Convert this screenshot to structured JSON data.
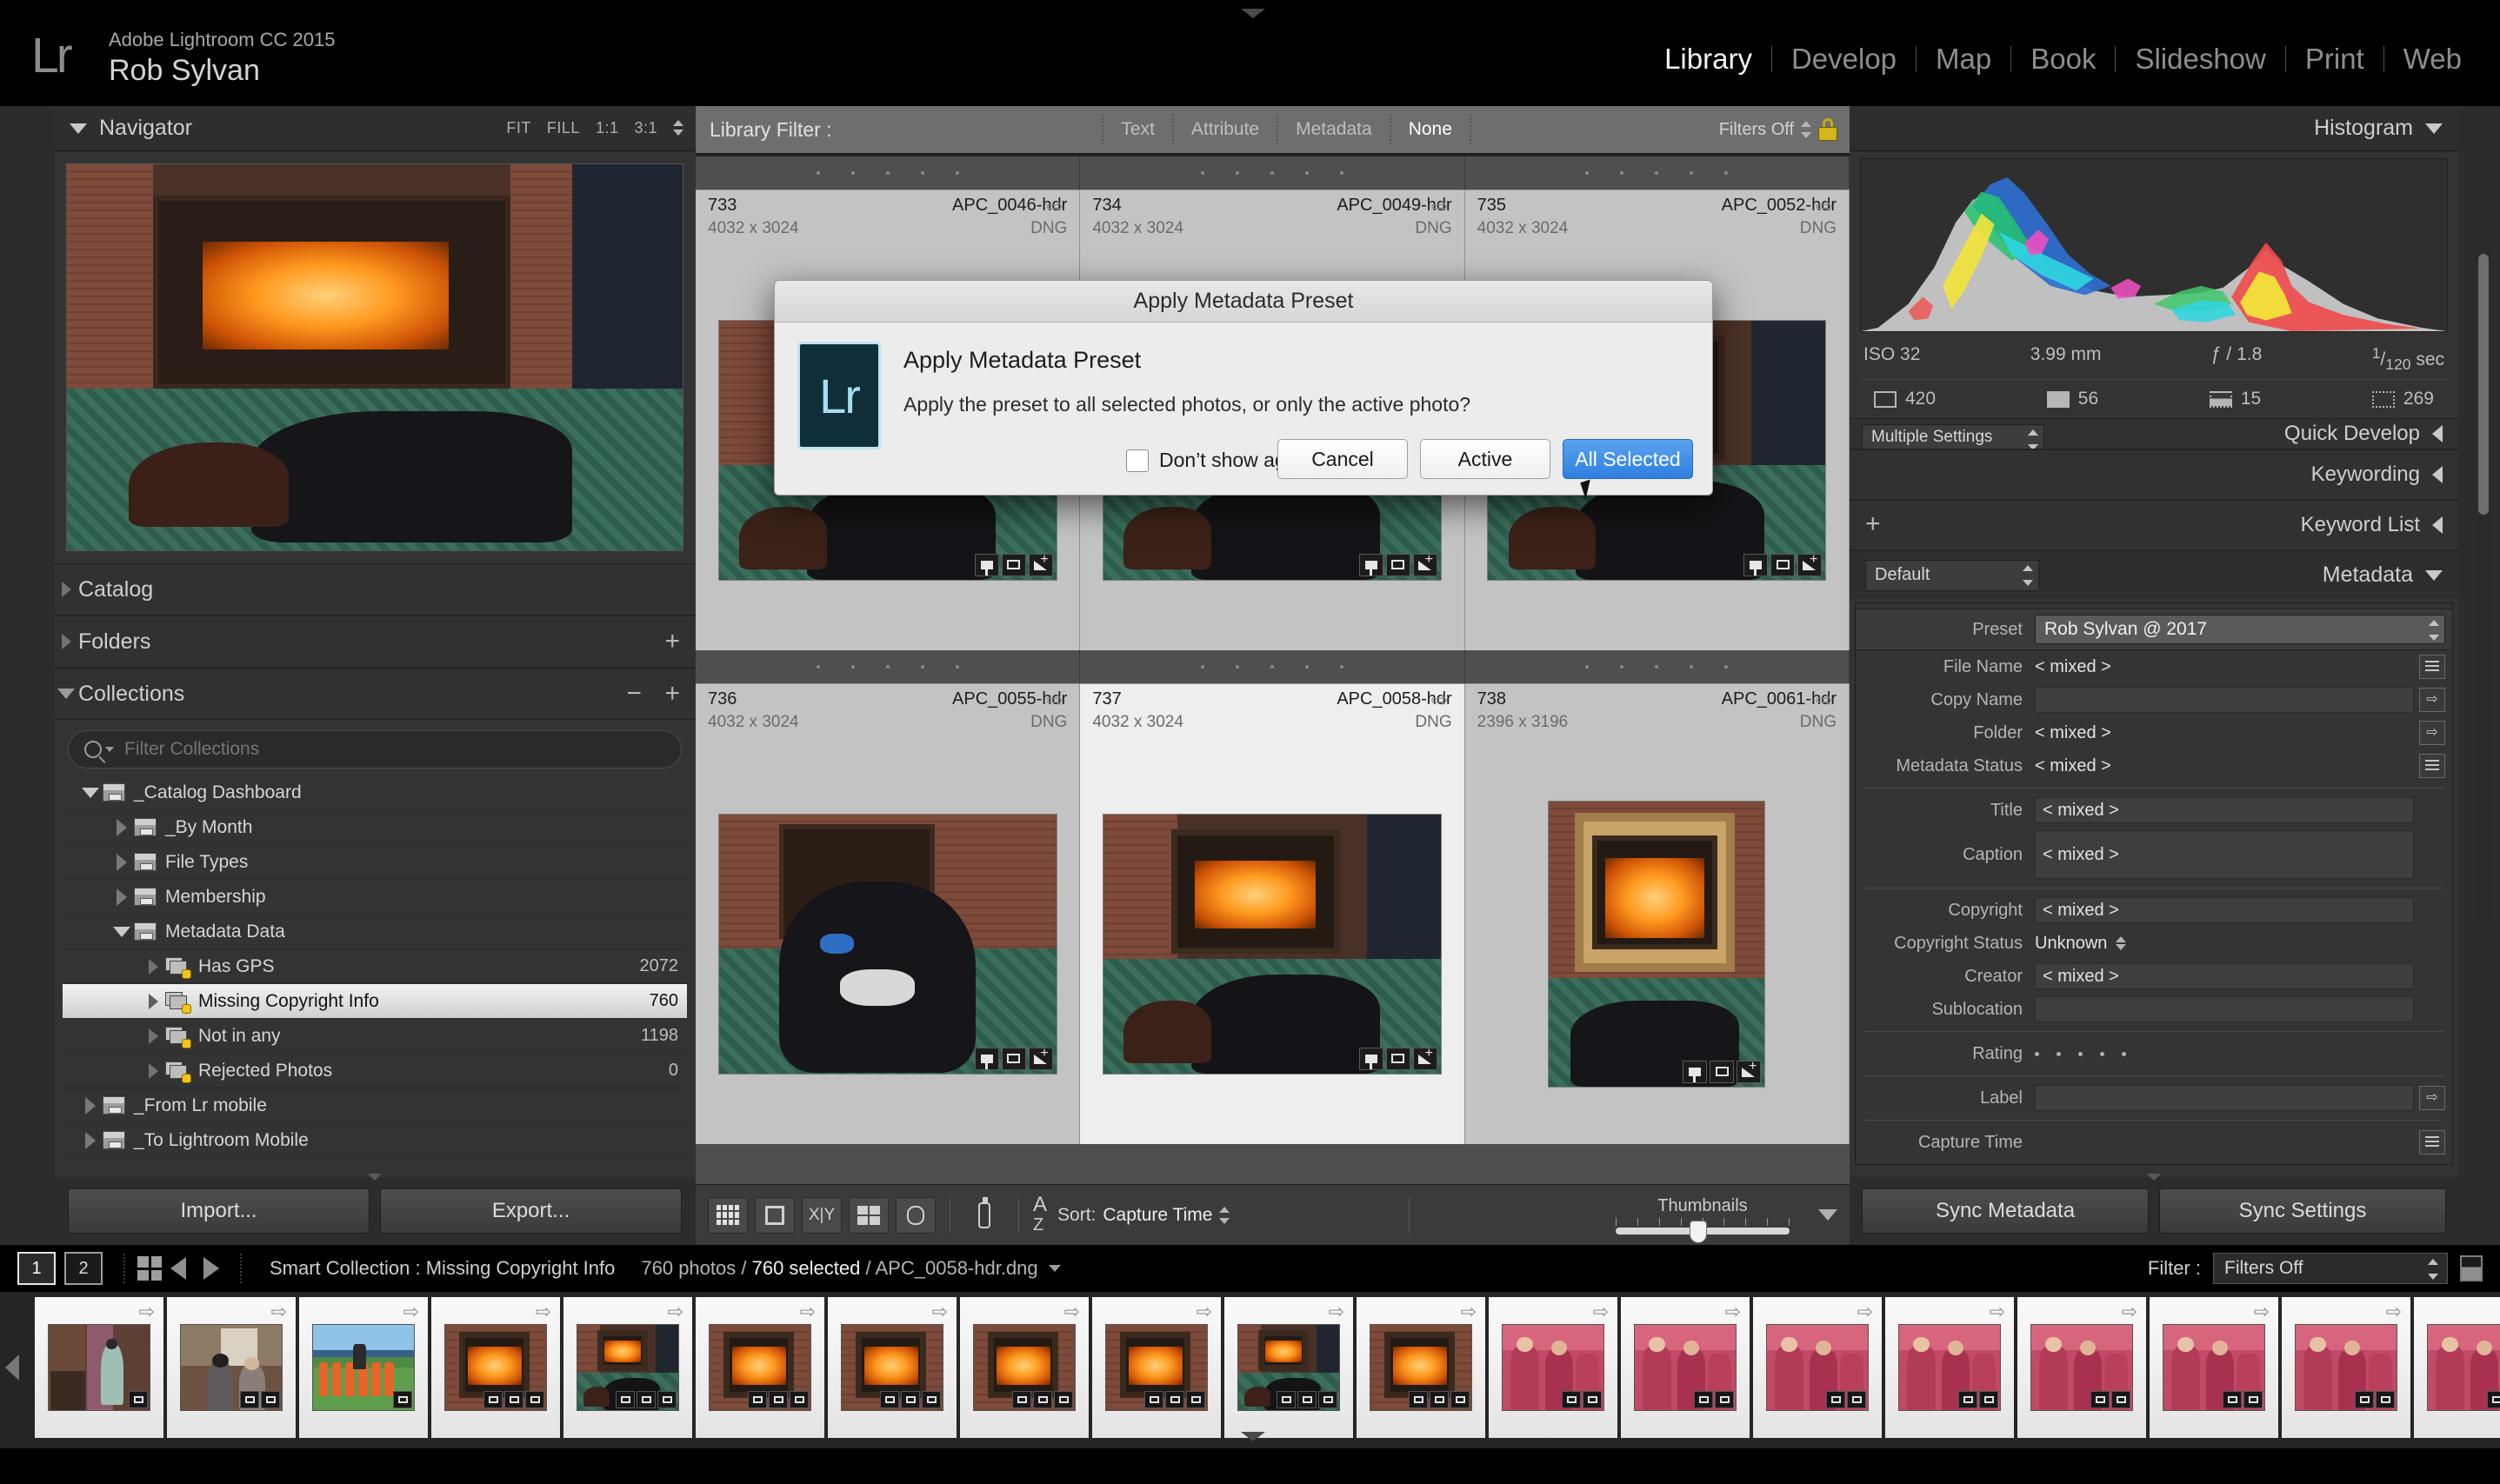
{
  "app": {
    "logo": "Lr",
    "identity_line1": "Adobe Lightroom CC 2015",
    "identity_line2": "Rob Sylvan"
  },
  "modules": [
    {
      "label": "Library",
      "active": true
    },
    {
      "label": "Develop",
      "active": false
    },
    {
      "label": "Map",
      "active": false
    },
    {
      "label": "Book",
      "active": false
    },
    {
      "label": "Slideshow",
      "active": false
    },
    {
      "label": "Print",
      "active": false
    },
    {
      "label": "Web",
      "active": false
    }
  ],
  "left_panel": {
    "navigator": {
      "title": "Navigator",
      "zoom_levels": [
        "FIT",
        "FILL",
        "1:1",
        "3:1"
      ]
    },
    "sections": [
      {
        "label": "Catalog",
        "expanded": false
      },
      {
        "label": "Folders",
        "expanded": false
      },
      {
        "label": "Collections",
        "expanded": true
      }
    ],
    "filter_placeholder": "Filter Collections",
    "collections": [
      {
        "label": "_Catalog Dashboard",
        "count": "",
        "indent": 0,
        "expanded": true,
        "type": "set",
        "selected": false
      },
      {
        "label": "_By Month",
        "count": "",
        "indent": 1,
        "expanded": false,
        "type": "set",
        "selected": false
      },
      {
        "label": "File Types",
        "count": "",
        "indent": 1,
        "expanded": false,
        "type": "set",
        "selected": false
      },
      {
        "label": "Membership",
        "count": "",
        "indent": 1,
        "expanded": false,
        "type": "set",
        "selected": false
      },
      {
        "label": "Metadata Data",
        "count": "",
        "indent": 1,
        "expanded": true,
        "type": "set",
        "selected": false
      },
      {
        "label": "Has GPS",
        "count": "2072",
        "indent": 2,
        "expanded": false,
        "type": "smart",
        "selected": false
      },
      {
        "label": "Missing Copyright Info",
        "count": "760",
        "indent": 2,
        "expanded": false,
        "type": "smart",
        "selected": true
      },
      {
        "label": "Not in any",
        "count": "1198",
        "indent": 2,
        "expanded": false,
        "type": "smart",
        "selected": false
      },
      {
        "label": "Rejected Photos",
        "count": "0",
        "indent": 2,
        "expanded": false,
        "type": "smart",
        "selected": false
      },
      {
        "label": "_From Lr mobile",
        "count": "",
        "indent": 0,
        "expanded": false,
        "type": "set",
        "selected": false
      },
      {
        "label": "_To Lightroom Mobile",
        "count": "",
        "indent": 0,
        "expanded": false,
        "type": "set",
        "selected": false
      }
    ],
    "buttons": {
      "import": "Import...",
      "export": "Export..."
    }
  },
  "library_filter": {
    "label": "Library Filter :",
    "items": [
      {
        "label": "Text",
        "active": false
      },
      {
        "label": "Attribute",
        "active": false
      },
      {
        "label": "Metadata",
        "active": false
      },
      {
        "label": "None",
        "active": true
      }
    ],
    "filters_state": "Filters Off"
  },
  "grid": {
    "rows": [
      [
        {
          "index": "733",
          "filename": "APC_0046-hdr",
          "dimensions": "4032 x 3024",
          "format": "DNG",
          "active": false,
          "photo": "fireplace-dog"
        },
        {
          "index": "734",
          "filename": "APC_0049-hdr",
          "dimensions": "4032 x 3024",
          "format": "DNG",
          "active": false,
          "photo": "fireplace-dog"
        },
        {
          "index": "735",
          "filename": "APC_0052-hdr",
          "dimensions": "4032 x 3024",
          "format": "DNG",
          "active": false,
          "photo": "fireplace-dog"
        }
      ],
      [
        {
          "index": "736",
          "filename": "APC_0055-hdr",
          "dimensions": "4032 x 3024",
          "format": "DNG",
          "active": false,
          "photo": "dog-portrait"
        },
        {
          "index": "737",
          "filename": "APC_0058-hdr",
          "dimensions": "4032 x 3024",
          "format": "DNG",
          "active": true,
          "photo": "fireplace-dog"
        },
        {
          "index": "738",
          "filename": "APC_0061-hdr",
          "dimensions": "2396 x 3196",
          "format": "DNG",
          "active": false,
          "photo": "fireplace-tall"
        }
      ]
    ]
  },
  "toolbar": {
    "sort_label": "Sort:",
    "sort_value": "Capture Time",
    "thumbnails_label": "Thumbnails",
    "view_buttons": [
      "grid-view",
      "loupe-view",
      "compare-view",
      "survey-view",
      "people-view"
    ],
    "painter": "spray-can"
  },
  "right_panel": {
    "histogram": {
      "title": "Histogram",
      "iso": "ISO 32",
      "focal_length": "3.99 mm",
      "aperture": "ƒ / 1.8",
      "shutter_num": "1",
      "shutter_den": "120",
      "shutter_unit": "sec",
      "counts": [
        "420",
        "56",
        "15",
        "269"
      ]
    },
    "sections": [
      {
        "label": "Quick Develop",
        "sub": "Multiple Settings"
      },
      {
        "label": "Keywording",
        "sub": ""
      },
      {
        "label": "Keyword List",
        "sub": ""
      }
    ],
    "metadata": {
      "title": "Metadata",
      "view_set": "Default",
      "preset_label": "Preset",
      "preset_value": "Rob Sylvan @ 2017",
      "fields": [
        {
          "label": "File Name",
          "value": "< mixed >",
          "kind": "plain",
          "button": "lines"
        },
        {
          "label": "Copy Name",
          "value": "",
          "kind": "field",
          "button": "arrow"
        },
        {
          "label": "Folder",
          "value": "< mixed >",
          "kind": "plain",
          "button": "arrow"
        },
        {
          "label": "Metadata Status",
          "value": "< mixed >",
          "kind": "plain",
          "button": "lines"
        }
      ],
      "fields2": [
        {
          "label": "Title",
          "value": "< mixed >",
          "kind": "field",
          "button": "none"
        },
        {
          "label": "Caption",
          "value": "< mixed >",
          "kind": "field-tall",
          "button": "none"
        }
      ],
      "fields3": [
        {
          "label": "Copyright",
          "value": "< mixed >",
          "kind": "field",
          "button": "none"
        },
        {
          "label": "Copyright Status",
          "value": "Unknown",
          "kind": "stepper",
          "button": "none"
        },
        {
          "label": "Creator",
          "value": "< mixed >",
          "kind": "field",
          "button": "none"
        },
        {
          "label": "Sublocation",
          "value": "",
          "kind": "field",
          "button": "none"
        }
      ],
      "rating_label": "Rating",
      "label_label": "Label",
      "capture_time_label": "Capture Time"
    },
    "buttons": {
      "sync_metadata": "Sync Metadata",
      "sync_settings": "Sync Settings"
    }
  },
  "status_bar": {
    "screen_buttons": [
      "1",
      "2"
    ],
    "source": "Smart Collection : Missing Copyright Info",
    "photo_count": "760 photos /",
    "selected_count": "760 selected",
    "active_file": "/ APC_0058-hdr.dng",
    "filter_label": "Filter :",
    "filter_value": "Filters Off"
  },
  "modal": {
    "window_title": "Apply Metadata Preset",
    "heading": "Apply Metadata Preset",
    "message": "Apply the preset to all selected photos, or only the active photo?",
    "checkbox_label": "Don’t show again",
    "icon_text": "Lr",
    "buttons": [
      {
        "label": "Cancel",
        "primary": false
      },
      {
        "label": "Active",
        "primary": false
      },
      {
        "label": "All Selected",
        "primary": true
      }
    ],
    "accent_color": "#2f7fe0"
  },
  "filmstrip": {
    "items": [
      {
        "photo": "indoor-person",
        "selected": true,
        "badges": 1
      },
      {
        "photo": "indoor-two",
        "selected": true,
        "badges": 2
      },
      {
        "photo": "group-outdoor",
        "selected": true,
        "badges": 1
      },
      {
        "photo": "fireplace",
        "selected": true,
        "badges": 3
      },
      {
        "photo": "fireplace-dog",
        "selected": true,
        "badges": 3
      },
      {
        "photo": "fireplace",
        "selected": true,
        "badges": 3
      },
      {
        "photo": "fireplace",
        "selected": true,
        "badges": 3
      },
      {
        "photo": "fireplace",
        "selected": true,
        "badges": 3
      },
      {
        "photo": "fireplace",
        "selected": true,
        "badges": 3
      },
      {
        "photo": "fireplace-dog",
        "selected": true,
        "badges": 3
      },
      {
        "photo": "fireplace",
        "selected": true,
        "badges": 3
      },
      {
        "photo": "pink-group",
        "selected": true,
        "badges": 2
      },
      {
        "photo": "pink-group",
        "selected": true,
        "badges": 2
      },
      {
        "photo": "pink-group",
        "selected": true,
        "badges": 2
      },
      {
        "photo": "pink-group",
        "selected": true,
        "badges": 2
      },
      {
        "photo": "pink-group",
        "selected": true,
        "badges": 2
      },
      {
        "photo": "pink-group",
        "selected": true,
        "badges": 2
      },
      {
        "photo": "pink-group",
        "selected": true,
        "badges": 2
      },
      {
        "photo": "pink-group",
        "selected": true,
        "badges": 2
      }
    ]
  }
}
